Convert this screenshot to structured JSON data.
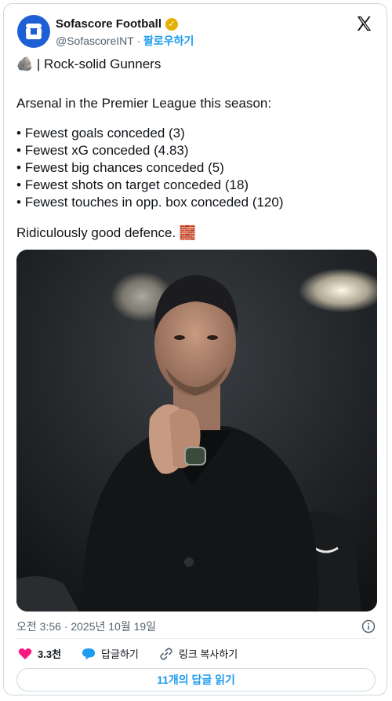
{
  "account": {
    "name": "Sofascore Football",
    "handle": "@SofascoreINT",
    "separator": "·",
    "follow_label": "팔로우하기"
  },
  "tweet": {
    "title_emoji": "🪨",
    "title_text": "| Rock-solid Gunners",
    "intro": "Arsenal in the Premier League this season:",
    "bullets": [
      "Fewest goals conceded (3)",
      "Fewest xG conceded (4.83)",
      "Fewest big chances conceded (5)",
      "Fewest shots on target conceded (18)",
      "Fewest touches in opp. box conceded (120)"
    ],
    "closing": "Ridiculously good defence.",
    "closing_emoji": "🧱"
  },
  "meta": {
    "timestamp": "오전 3:56 · 2025년 10월 19일"
  },
  "actions": {
    "like_count": "3.3천",
    "reply_label": "답글하기",
    "copy_link_label": "링크 복사하기"
  },
  "replies_button": "11개의 답글 읽기",
  "colors": {
    "accent_blue": "#1d9bf0",
    "like_pink": "#f91880",
    "verified_gold": "#e6b000",
    "avatar_blue": "#1f5fd6"
  },
  "icons": {
    "avatar": "sofascore-logo-icon",
    "verified": "verified-badge-icon",
    "platform": "x-logo-icon",
    "info": "info-icon",
    "like": "heart-icon",
    "reply": "speech-bubble-icon",
    "link": "link-icon"
  }
}
